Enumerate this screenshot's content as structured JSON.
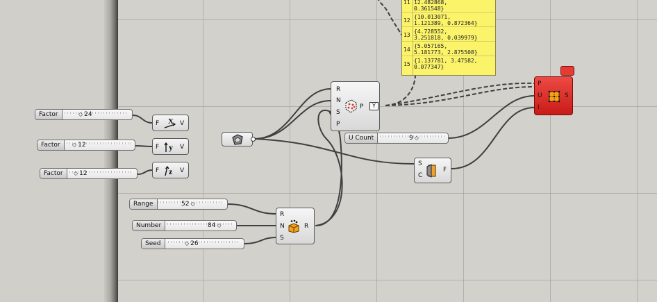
{
  "sliders": {
    "factor_x": {
      "label": "Factor",
      "value": "24"
    },
    "factor_y": {
      "label": "Factor",
      "value": "12"
    },
    "factor_z": {
      "label": "Factor",
      "value": "12"
    },
    "range": {
      "label": "Range",
      "value": "52"
    },
    "number": {
      "label": "Number",
      "value": "84"
    },
    "seed": {
      "label": "Seed",
      "value": "26"
    },
    "u_count": {
      "label": "U Count",
      "value": "9"
    }
  },
  "components": {
    "unit_x": {
      "inputs": [
        "F"
      ],
      "outputs": [
        "V"
      ],
      "icon": "unit-x-icon"
    },
    "unit_y": {
      "inputs": [
        "F"
      ],
      "outputs": [
        "V"
      ],
      "icon": "unit-y-icon"
    },
    "unit_z": {
      "inputs": [
        "F"
      ],
      "outputs": [
        "V"
      ],
      "icon": "unit-z-icon"
    },
    "populate": {
      "inputs": [
        "R",
        "N",
        "S",
        "P"
      ],
      "outputs": [
        "P"
      ],
      "icon": "populate-3d-icon"
    },
    "random": {
      "inputs": [
        "R",
        "N",
        "S"
      ],
      "outputs": [
        "R"
      ],
      "icon": "random-icon"
    },
    "surface_from_points": {
      "inputs": [
        "P",
        "U",
        "I"
      ],
      "outputs": [
        "S"
      ],
      "icon": "surface-from-points-icon"
    },
    "brep": {
      "inputs": [],
      "outputs": [],
      "icon": "brep-param-icon"
    },
    "cap": {
      "inputs": [
        "S",
        "C"
      ],
      "outputs": [
        "F"
      ],
      "icon": "cap-holes-icon"
    }
  },
  "panel": {
    "rows": [
      {
        "index": "11",
        "lines": [
          "12.482868,",
          "0.361548}"
        ]
      },
      {
        "index": "12",
        "lines": [
          "{10.013071,",
          "1.121389, 0.872364}"
        ]
      },
      {
        "index": "13",
        "lines": [
          "{4.728552,",
          "3.251818, 0.039979}"
        ]
      },
      {
        "index": "14",
        "lines": [
          "{5.057165,",
          "5.181773, 2.875508}"
        ]
      },
      {
        "index": "15",
        "lines": [
          "{1.137781, 3.47582,",
          "0.077347}"
        ]
      }
    ]
  },
  "colors": {
    "canvas": "#d2d1cc",
    "wire": "#3f3f3f",
    "panel": "#fbf36a",
    "error_component": "#d9231e"
  }
}
